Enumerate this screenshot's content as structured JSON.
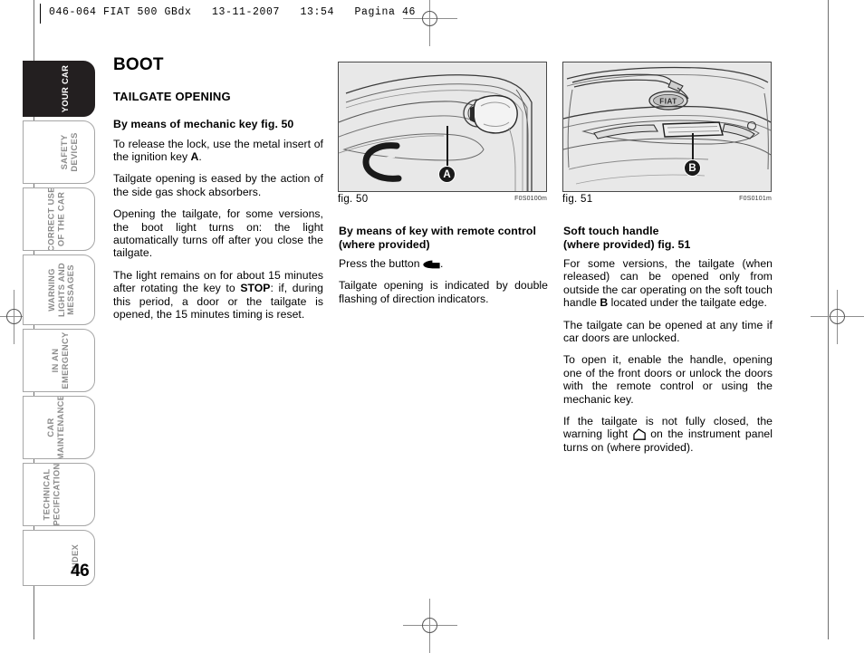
{
  "header": {
    "text": "046-064 FIAT 500 GBdx   13-11-2007   13:54   Pagina 46"
  },
  "page_number": "46",
  "tabs": [
    {
      "label": "YOUR CAR",
      "active": true
    },
    {
      "label": "SAFETY\nDEVICES",
      "active": false
    },
    {
      "label": "CORRECT USE\nOF THE CAR",
      "active": false
    },
    {
      "label": "WARNING\nLIGHTS AND\nMESSAGES",
      "active": false
    },
    {
      "label": "IN AN\nEMERGENCY",
      "active": false
    },
    {
      "label": "CAR\nMAINTENANCE",
      "active": false
    },
    {
      "label": "TECHNICAL\nSPECIFICATIONS",
      "active": false
    },
    {
      "label": "INDEX",
      "active": false
    }
  ],
  "left_column": {
    "title": "BOOT",
    "subtitle": "TAILGATE OPENING",
    "section_head": "By means of mechanic key fig. 50",
    "p1_a": "To release the lock, use the metal insert of the ignition key ",
    "p1_bold": "A",
    "p1_b": ".",
    "p2": "Tailgate opening is eased by the action of the side gas shock absorbers.",
    "p3": "Opening the tailgate, for some versions, the boot light turns on: the light automatically turns off after you close the tailgate.",
    "p4_a": "The light remains on for about 15 minutes after rotating the key to ",
    "p4_bold": "STOP",
    "p4_b": ": if, during this period, a door or the tailgate is opened, the 15 minutes timing is reset."
  },
  "middle_column": {
    "section_head": "By means of key with remote control (where provided)",
    "p1_a": "Press the button ",
    "p1_icon": "boot-open-solid-icon",
    "p1_b": ".",
    "p2": "Tailgate opening is indicated by double flashing of direction indicators."
  },
  "right_column": {
    "section_head": "Soft touch handle\n(where provided) fig. 51",
    "p1_a": "For some versions, the tailgate (when released) can be opened only from outside the car operating on the soft touch handle ",
    "p1_bold": "B",
    "p1_b": " located under the tailgate edge.",
    "p2": "The tailgate can be opened at any time if car doors are unlocked.",
    "p3": "To open it, enable the handle, opening one of the front doors or unlock the doors with the remote control or using the mechanic key.",
    "p4_a": "If the tailgate is not fully closed, the warning light ",
    "p4_icon": "boot-open-outline-icon",
    "p4_b": " on the instrument panel turns on (where provided)."
  },
  "figures": [
    {
      "name": "fig. 50",
      "code": "F0S0100m",
      "callout": "A",
      "description": "tailgate lock with key insert"
    },
    {
      "name": "fig. 51",
      "code": "F0S0101m",
      "callout": "B",
      "badge": "FIAT",
      "description": "rear of car showing soft touch handle under tailgate edge"
    }
  ],
  "colors": {
    "active_tab_bg": "#231f20",
    "tab_border": "#a6a6a6",
    "tab_text": "#8c8c8c",
    "figure_bg": "#e8e8e8",
    "figure_border": "#4a4a4a"
  }
}
